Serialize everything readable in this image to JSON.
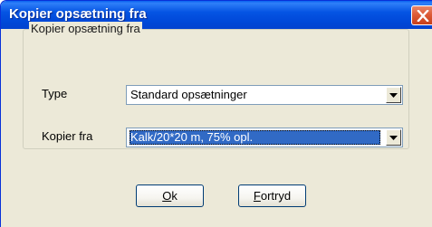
{
  "window": {
    "title": "Kopier opsætning fra"
  },
  "group": {
    "legend": "Kopier opsætning fra"
  },
  "fields": {
    "type_label": "Type",
    "type_value": "Standard opsætninger",
    "kopier_fra_label": "Kopier fra",
    "kopier_fra_value": "Kalk/20*20 m, 75% opl."
  },
  "buttons": {
    "ok_mnemonic": "O",
    "ok_rest": "k",
    "cancel_mnemonic": "F",
    "cancel_rest": "ortryd"
  },
  "icons": {
    "close": "close-icon",
    "dropdown": "chevron-down-icon"
  },
  "colors": {
    "titlebar": "#0054e3",
    "close_button": "#d9582f",
    "selection": "#316ac5",
    "face": "#ece9d8"
  }
}
